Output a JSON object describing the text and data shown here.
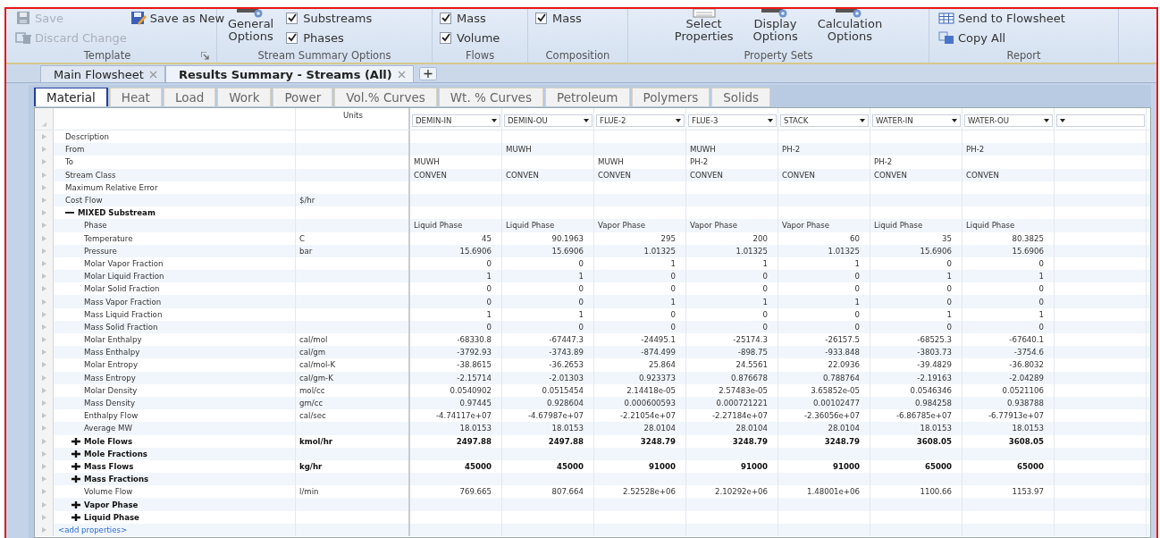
{
  "ribbon": {
    "template": {
      "label": "Template",
      "items": [
        {
          "label": "Save",
          "disabled": true
        },
        {
          "label": "Save as New",
          "disabled": false
        },
        {
          "label": "Discard Change",
          "disabled": true
        }
      ]
    },
    "stream_summary_options": {
      "label": "Stream Summary Options",
      "button": "General Options",
      "checkboxes": [
        {
          "label": "Substreams",
          "checked": true
        },
        {
          "label": "Phases",
          "checked": true
        }
      ]
    },
    "flows": {
      "label": "Flows",
      "checkboxes": [
        {
          "label": "Mass",
          "checked": true
        },
        {
          "label": "Volume",
          "checked": true
        }
      ]
    },
    "composition": {
      "label": "Composition",
      "checkboxes": [
        {
          "label": "Mass",
          "checked": true
        }
      ]
    },
    "property_sets": {
      "label": "Property Sets",
      "buttons": [
        "Select Properties",
        "Display Options",
        "Calculation Options"
      ]
    },
    "report": {
      "label": "Report",
      "items": [
        "Send to Flowsheet",
        "Copy All"
      ]
    }
  },
  "document_tabs": [
    {
      "label": "Main Flowsheet",
      "selected": false
    },
    {
      "label": "Results Summary - Streams (All)",
      "selected": true
    }
  ],
  "tabs": [
    {
      "label": "Material",
      "selected": true
    },
    {
      "label": "Heat",
      "selected": false
    },
    {
      "label": "Load",
      "selected": false
    },
    {
      "label": "Work",
      "selected": false
    },
    {
      "label": "Power",
      "selected": false
    },
    {
      "label": "Vol.% Curves",
      "selected": false
    },
    {
      "label": "Wt. % Curves",
      "selected": false
    },
    {
      "label": "Petroleum",
      "selected": false
    },
    {
      "label": "Polymers",
      "selected": false
    },
    {
      "label": "Solids",
      "selected": false
    }
  ],
  "table": {
    "units_header": "Units",
    "streams": [
      "DEMIN-IN",
      "DEMIN-OU",
      "FLUE-2",
      "FLUE-3",
      "STACK",
      "WATER-IN",
      "WATER-OU"
    ],
    "rows": [
      {
        "kind": "text",
        "name": "Description"
      },
      {
        "kind": "text",
        "name": "From",
        "values": {
          "column_2": "MUWH",
          "column_4": "MUWH",
          "column_5": "PH-2",
          "column_7": "PH-2"
        }
      },
      {
        "kind": "text",
        "name": "To",
        "values": {
          "column_1": "MUWH",
          "column_3": "MUWH",
          "column_4": "PH-2",
          "column_6": "PH-2"
        }
      },
      {
        "kind": "text",
        "name": "Stream Class",
        "values": {
          "column_1": "CONVEN",
          "column_2": "CONVEN",
          "column_3": "CONVEN",
          "column_4": "CONVEN",
          "column_5": "CONVEN",
          "column_6": "CONVEN",
          "column_7": "CONVEN"
        }
      },
      {
        "kind": "text",
        "name": "Maximum Relative Error"
      },
      {
        "kind": "number",
        "name": "Cost Flow",
        "units": "$/hr"
      },
      {
        "kind": "section",
        "name": "MIXED Substream",
        "expanded": true,
        "children": [
          {
            "kind": "text",
            "name": "Phase",
            "values": {
              "column_1": "Liquid Phase",
              "column_2": "Liquid Phase",
              "column_3": "Vapor Phase",
              "column_4": "Vapor Phase",
              "column_5": "Vapor Phase",
              "column_6": "Liquid Phase",
              "column_7": "Liquid Phase"
            }
          },
          {
            "kind": "number",
            "name": "Temperature",
            "units": "C",
            "values": {
              "column_1": "45",
              "column_2": "90.1963",
              "column_3": "295",
              "column_4": "200",
              "column_5": "60",
              "column_6": "35",
              "column_7": "80.3825"
            }
          },
          {
            "kind": "number",
            "name": "Pressure",
            "units": "bar",
            "values": {
              "column_1": "15.6906",
              "column_2": "15.6906",
              "column_3": "1.01325",
              "column_4": "1.01325",
              "column_5": "1.01325",
              "column_6": "15.6906",
              "column_7": "15.6906"
            }
          },
          {
            "kind": "number",
            "name": "Molar Vapor Fraction",
            "values": {
              "column_1": "0",
              "column_2": "0",
              "column_3": "1",
              "column_4": "1",
              "column_5": "1",
              "column_6": "0",
              "column_7": "0"
            }
          },
          {
            "kind": "number",
            "name": "Molar Liquid Fraction",
            "values": {
              "column_1": "1",
              "column_2": "1",
              "column_3": "0",
              "column_4": "0",
              "column_5": "0",
              "column_6": "1",
              "column_7": "1"
            }
          },
          {
            "kind": "number",
            "name": "Molar Solid Fraction",
            "values": {
              "column_1": "0",
              "column_2": "0",
              "column_3": "0",
              "column_4": "0",
              "column_5": "0",
              "column_6": "0",
              "column_7": "0"
            }
          },
          {
            "kind": "number",
            "name": "Mass Vapor Fraction",
            "values": {
              "column_1": "0",
              "column_2": "0",
              "column_3": "1",
              "column_4": "1",
              "column_5": "1",
              "column_6": "0",
              "column_7": "0"
            }
          },
          {
            "kind": "number",
            "name": "Mass Liquid Fraction",
            "values": {
              "column_1": "1",
              "column_2": "1",
              "column_3": "0",
              "column_4": "0",
              "column_5": "0",
              "column_6": "1",
              "column_7": "1"
            }
          },
          {
            "kind": "number",
            "name": "Mass Solid Fraction",
            "values": {
              "column_1": "0",
              "column_2": "0",
              "column_3": "0",
              "column_4": "0",
              "column_5": "0",
              "column_6": "0",
              "column_7": "0"
            }
          },
          {
            "kind": "number",
            "name": "Molar Enthalpy",
            "units": "cal/mol",
            "values": {
              "column_1": "-68330.8",
              "column_2": "-67447.3",
              "column_3": "-24495.1",
              "column_4": "-25174.3",
              "column_5": "-26157.5",
              "column_6": "-68525.3",
              "column_7": "-67640.1"
            }
          },
          {
            "kind": "number",
            "name": "Mass Enthalpy",
            "units": "cal/gm",
            "values": {
              "column_1": "-3792.93",
              "column_2": "-3743.89",
              "column_3": "-874.499",
              "column_4": "-898.75",
              "column_5": "-933.848",
              "column_6": "-3803.73",
              "column_7": "-3754.6"
            }
          },
          {
            "kind": "number",
            "name": "Molar Entropy",
            "units": "cal/mol-K",
            "values": {
              "column_1": "-38.8615",
              "column_2": "-36.2653",
              "column_3": "25.864",
              "column_4": "24.5561",
              "column_5": "22.0936",
              "column_6": "-39.4829",
              "column_7": "-36.8032"
            }
          },
          {
            "kind": "number",
            "name": "Mass Entropy",
            "units": "cal/gm-K",
            "values": {
              "column_1": "-2.15714",
              "column_2": "-2.01303",
              "column_3": "0.923373",
              "column_4": "0.876678",
              "column_5": "0.788764",
              "column_6": "-2.19163",
              "column_7": "-2.04289"
            }
          },
          {
            "kind": "number",
            "name": "Molar Density",
            "units": "mol/cc",
            "values": {
              "column_1": "0.0540902",
              "column_2": "0.0515454",
              "column_3": "2.14418e-05",
              "column_4": "2.57483e-05",
              "column_5": "3.65852e-05",
              "column_6": "0.0546346",
              "column_7": "0.0521106"
            }
          },
          {
            "kind": "number",
            "name": "Mass Density",
            "units": "gm/cc",
            "values": {
              "column_1": "0.97445",
              "column_2": "0.928604",
              "column_3": "0.000600593",
              "column_4": "0.000721221",
              "column_5": "0.00102477",
              "column_6": "0.984258",
              "column_7": "0.938788"
            }
          },
          {
            "kind": "number",
            "name": "Enthalpy Flow",
            "units": "cal/sec",
            "values": {
              "column_1": "-4.74117e+07",
              "column_2": "-4.67987e+07",
              "column_3": "-2.21054e+07",
              "column_4": "-2.27184e+07",
              "column_5": "-2.36056e+07",
              "column_6": "-6.86785e+07",
              "column_7": "-6.77913e+07"
            }
          },
          {
            "kind": "number",
            "name": "Average MW",
            "values": {
              "column_1": "18.0153",
              "column_2": "18.0153",
              "column_3": "28.0104",
              "column_4": "28.0104",
              "column_5": "28.0104",
              "column_6": "18.0153",
              "column_7": "18.0153"
            }
          },
          {
            "kind": "group",
            "name": "Mole Flows",
            "expanded": false,
            "units": "kmol/hr",
            "values": {
              "column_1": "2497.88",
              "column_2": "2497.88",
              "column_3": "3248.79",
              "column_4": "3248.79",
              "column_5": "3248.79",
              "column_6": "3608.05",
              "column_7": "3608.05"
            }
          },
          {
            "kind": "group",
            "name": "Mole Fractions",
            "expanded": false
          },
          {
            "kind": "group",
            "name": "Mass Flows",
            "expanded": false,
            "units": "kg/hr",
            "values": {
              "column_1": "45000",
              "column_2": "45000",
              "column_3": "91000",
              "column_4": "91000",
              "column_5": "91000",
              "column_6": "65000",
              "column_7": "65000"
            }
          },
          {
            "kind": "group",
            "name": "Mass Fractions",
            "expanded": false
          },
          {
            "kind": "number",
            "name": "Volume Flow",
            "units": "l/min",
            "values": {
              "column_1": "769.665",
              "column_2": "807.664",
              "column_3": "2.52528e+06",
              "column_4": "2.10292e+06",
              "column_5": "1.48001e+06",
              "column_6": "1100.66",
              "column_7": "1153.97"
            }
          },
          {
            "kind": "group",
            "name": "Vapor Phase",
            "expanded": false
          },
          {
            "kind": "group",
            "name": "Liquid Phase",
            "expanded": false
          }
        ]
      }
    ],
    "add_link": "<add properties>"
  }
}
